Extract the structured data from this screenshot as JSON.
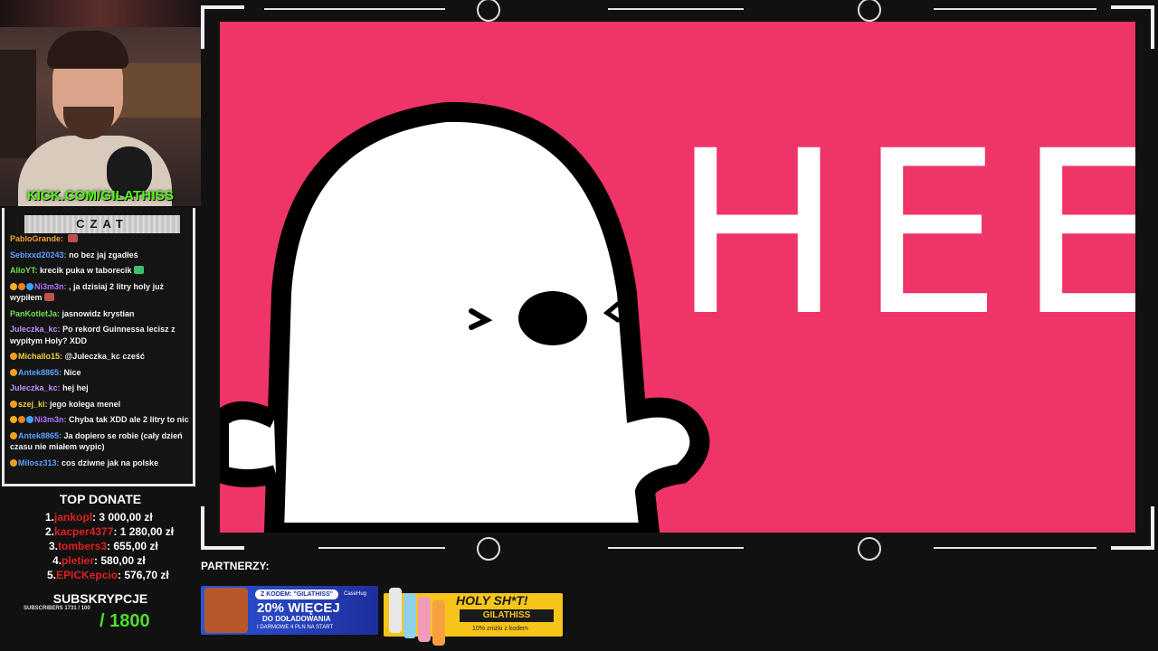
{
  "stream": {
    "kick_url": "KICK.COM/GILATHISS"
  },
  "chat": {
    "header": "CZAT",
    "messages": [
      {
        "user": "PabloGrande:",
        "user_color": "#f0a030",
        "text": "",
        "badges": [],
        "emote": true
      },
      {
        "user": "Sebixxd20243:",
        "user_color": "#5aa0ff",
        "text": "no bez jaj zgadłeś",
        "badges": []
      },
      {
        "user": "AlloYT:",
        "user_color": "#6fe04a",
        "text": "krecik puka w taborecik",
        "badges": [],
        "emote": true
      },
      {
        "user": "Ni3m3n:",
        "user_color": "#b070ff",
        "text": ", ja dzisiaj 2 litry holy już wypiłem",
        "badges": [
          "#f0b020",
          "#f08020",
          "#40a0ff"
        ],
        "emote": true
      },
      {
        "user": "PanKotletJa:",
        "user_color": "#6fe04a",
        "text": "jasnowidz krystian",
        "badges": []
      },
      {
        "user": "Juleczka_kc:",
        "user_color": "#c090ff",
        "text": "Po rekord Guinnessa lecisz z wypitym Holy? XDD",
        "badges": []
      },
      {
        "user": "Michallo15:",
        "user_color": "#f0d040",
        "text": "@Juleczka_kc cześć",
        "badges": [
          "#f0a020"
        ]
      },
      {
        "user": "Antek8865:",
        "user_color": "#5aa0ff",
        "text": "Nice",
        "badges": [
          "#f0a020"
        ]
      },
      {
        "user": "Juleczka_kc:",
        "user_color": "#c090ff",
        "text": "hej hej",
        "badges": []
      },
      {
        "user": "szej_ki:",
        "user_color": "#f0d040",
        "text": "jego kolega menel",
        "badges": [
          "#f0a020"
        ]
      },
      {
        "user": "Ni3m3n:",
        "user_color": "#b070ff",
        "text": "Chyba tak XDD ale 2 litry to nic",
        "badges": [
          "#f0b020",
          "#f08020",
          "#40a0ff"
        ]
      },
      {
        "user": "Antek8865:",
        "user_color": "#5aa0ff",
        "text": "Ja dopiero se robie (cały dzień czasu nie miałem wypic)",
        "badges": [
          "#f0a020"
        ]
      },
      {
        "user": "Milosz313:",
        "user_color": "#5aa0ff",
        "text": "cos dziwne jak na polske",
        "badges": [
          "#f0a020"
        ]
      }
    ]
  },
  "top_donate": {
    "title": "TOP DONATE",
    "entries": [
      {
        "rank": "1.",
        "name": "jankopl",
        "amount": ": 3 000,00 zł"
      },
      {
        "rank": "2.",
        "name": "kacper4377",
        "amount": ": 1 280,00 zł"
      },
      {
        "rank": "3.",
        "name": "tombers3",
        "amount": ": 655,00 zł"
      },
      {
        "rank": "4.",
        "name": "pletier",
        "amount": ": 580,00 zł"
      },
      {
        "rank": "5.",
        "name": "EPICKepcio",
        "amount": ": 576,70 zł"
      }
    ]
  },
  "subs": {
    "title": "SUBSKRYPCJE",
    "small": "SUBSCRIBERS 1731 / 100",
    "goal": "/ 1800"
  },
  "video": {
    "text": "HEE",
    "background": "#ef3467"
  },
  "partners": {
    "label": "PARTNERZY:",
    "banner1": {
      "code": "Z KODEM: \"GILATHISS\"",
      "logo": "CaseHug",
      "big": "20% WIĘCEJ",
      "mid": "DO DOŁADOWANIA",
      "small": "I DARMOWE 4 PLN NA START"
    },
    "banner2": {
      "title": "HOLY SH*T!",
      "code": "GILATHISS",
      "small": "10% zniżki z kodem"
    }
  }
}
